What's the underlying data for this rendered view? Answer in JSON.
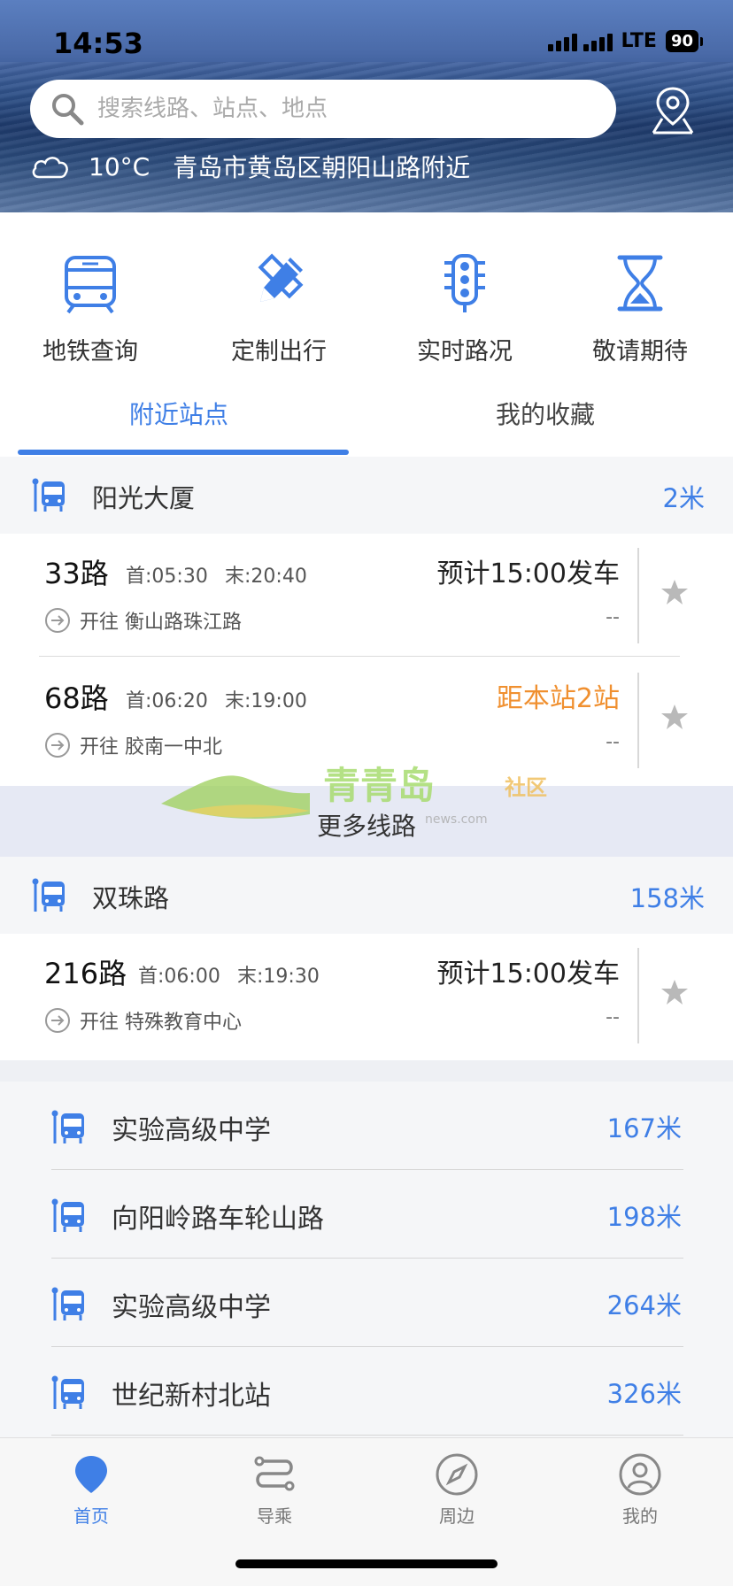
{
  "status_bar": {
    "time": "14:53",
    "network": "LTE",
    "battery": "90"
  },
  "header": {
    "search_placeholder": "搜索线路、站点、地点",
    "weather_icon": "cloud-icon",
    "temperature": "10°C",
    "location": "青岛市黄岛区朝阳山路附近"
  },
  "actions": [
    {
      "label": "地铁查询",
      "icon": "subway-icon"
    },
    {
      "label": "定制出行",
      "icon": "custom-trip-icon"
    },
    {
      "label": "实时路况",
      "icon": "traffic-light-icon"
    },
    {
      "label": "敬请期待",
      "icon": "hourglass-icon"
    }
  ],
  "tabs": [
    {
      "label": "附近站点",
      "active": true
    },
    {
      "label": "我的收藏",
      "active": false
    }
  ],
  "stations": [
    {
      "name": "阳光大厦",
      "distance": "2米",
      "routes": [
        {
          "number": "33路",
          "first": "首:05:30",
          "last": "末:20:40",
          "eta": "预计15:00发车",
          "eta_color": "#222222",
          "direction": "开往 衡山路珠江路",
          "extra": "--"
        },
        {
          "number": "68路",
          "first": "首:06:20",
          "last": "末:19:00",
          "eta": "距本站2站",
          "eta_color": "#f09030",
          "direction": "开往 胶南一中北",
          "extra": "--"
        }
      ],
      "more_label": "更多线路"
    },
    {
      "name": "双珠路",
      "distance": "158米",
      "routes": [
        {
          "number": "216路",
          "first": "首:06:00",
          "last": "末:19:30",
          "eta": "预计15:00发车",
          "eta_color": "#222222",
          "direction": "开往 特殊教育中心",
          "extra": "--"
        }
      ]
    }
  ],
  "nearby": [
    {
      "name": "实验高级中学",
      "distance": "167米"
    },
    {
      "name": "向阳岭路车轮山路",
      "distance": "198米"
    },
    {
      "name": "实验高级中学",
      "distance": "264米"
    },
    {
      "name": "世纪新村北站",
      "distance": "326米"
    }
  ],
  "watermark": {
    "text": "青青岛",
    "suffix": "社区",
    "url": "news.com"
  },
  "bottom_nav": [
    {
      "label": "首页",
      "icon": "home-pin-icon",
      "active": true
    },
    {
      "label": "导乘",
      "icon": "route-icon",
      "active": false
    },
    {
      "label": "周边",
      "icon": "compass-icon",
      "active": false
    },
    {
      "label": "我的",
      "icon": "user-icon",
      "active": false
    }
  ],
  "colors": {
    "accent": "#3f7fe6",
    "orange": "#f09030"
  }
}
